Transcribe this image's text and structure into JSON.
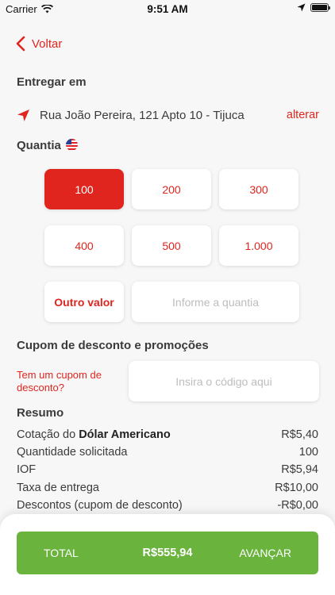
{
  "status": {
    "carrier": "Carrier",
    "time": "9:51 AM"
  },
  "nav": {
    "back_label": "Voltar"
  },
  "delivery": {
    "title": "Entregar em",
    "address": "Rua João Pereira, 121 Apto 10 - Tijuca",
    "change_label": "alterar"
  },
  "quantity": {
    "title": "Quantia",
    "currency_flag": "us-flag-icon",
    "options": [
      "100",
      "200",
      "300",
      "400",
      "500",
      "1.000"
    ],
    "selected": "100",
    "other_label": "Outro valor",
    "input_placeholder": "Informe a quantia"
  },
  "coupon": {
    "title": "Cupom de desconto e promoções",
    "question": "Tem um cupom de desconto?",
    "input_placeholder": "Insira o código aqui"
  },
  "summary": {
    "title": "Resumo",
    "quote_prefix": "Cotação do ",
    "quote_currency": "Dólar Americano",
    "quote_value": "R$5,40",
    "rows": [
      {
        "label": "Quantidade solicitada",
        "value": "100"
      },
      {
        "label": "IOF",
        "value": "R$5,94"
      },
      {
        "label": "Taxa de entrega",
        "value": "R$10,00"
      },
      {
        "label": "Descontos (cupom de desconto)",
        "value": "-R$0,00"
      }
    ]
  },
  "footer": {
    "total_label": "TOTAL",
    "total_value": "R$555,94",
    "advance_label": "AVANÇAR"
  },
  "colors": {
    "accent": "#e0251f",
    "success": "#6ab43e",
    "background": "#f7f7f7"
  }
}
